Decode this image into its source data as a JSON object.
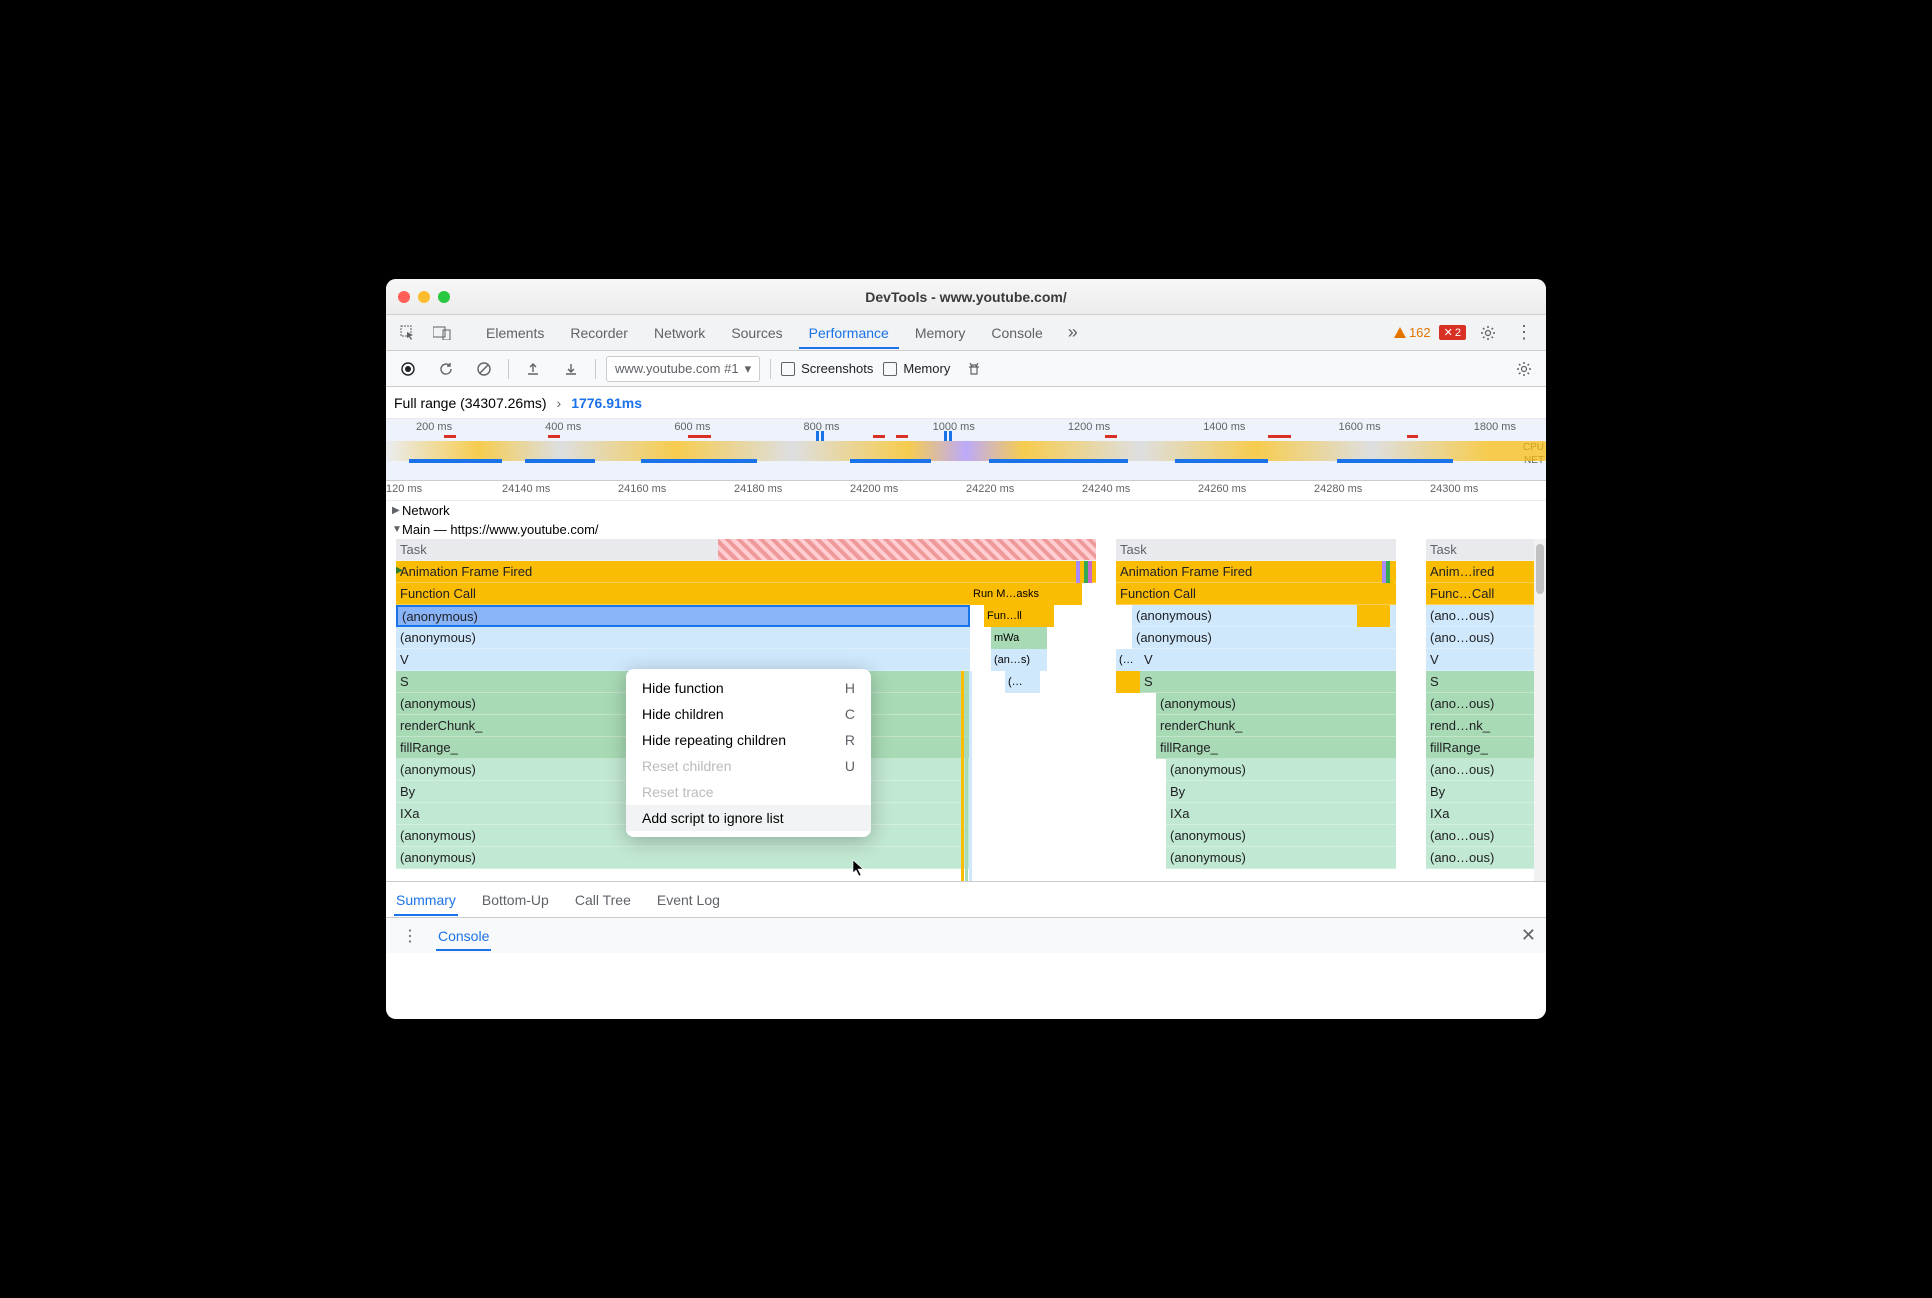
{
  "window_title": "DevTools - www.youtube.com/",
  "tabs": [
    "Elements",
    "Recorder",
    "Network",
    "Sources",
    "Performance",
    "Memory",
    "Console"
  ],
  "active_tab": "Performance",
  "warnings_count": "162",
  "errors_count": "2",
  "toolbar": {
    "dropdown": "www.youtube.com #1",
    "screenshots_label": "Screenshots",
    "memory_label": "Memory"
  },
  "breadcrumb": {
    "full_range": "Full range (34307.26ms)",
    "current": "1776.91ms"
  },
  "overview_ticks": [
    "200 ms",
    "400 ms",
    "600 ms",
    "800 ms",
    "1000 ms",
    "1200 ms",
    "1400 ms",
    "1600 ms",
    "1800 ms"
  ],
  "overview_right_labels": [
    "CPU",
    "NET"
  ],
  "sub_ticks": [
    "120 ms",
    "24140 ms",
    "24160 ms",
    "24180 ms",
    "24200 ms",
    "24220 ms",
    "24240 ms",
    "24260 ms",
    "24280 ms",
    "24300 ms"
  ],
  "sections": {
    "network": "Network",
    "main": "Main — https://www.youtube.com/"
  },
  "flame_main": [
    "Task",
    "Animation Frame Fired",
    "Function Call",
    "(anonymous)",
    "(anonymous)",
    "V",
    "S",
    "(anonymous)",
    "renderChunk_",
    "fillRange_",
    "(anonymous)",
    "By",
    "IXa",
    "(anonymous)",
    "(anonymous)"
  ],
  "flame_slices_side": {
    "run_tasks": "Run M…asks",
    "fun_ll": "Fun…ll",
    "mwa": "mWa",
    "an_s": "(an…s)",
    "paren": "(…"
  },
  "flame_col2": [
    "Task",
    "Animation Frame Fired",
    "Function Call",
    "(anonymous)",
    "(anonymous)",
    "V",
    "S",
    "(anonymous)",
    "renderChunk_",
    "fillRange_",
    "(anonymous)",
    "By",
    "IXa",
    "(anonymous)",
    "(anonymous)"
  ],
  "flame_col2_side": "(…",
  "flame_col3": [
    "Task",
    "Anim…ired",
    "Func…Call",
    "(ano…ous)",
    "(ano…ous)",
    "V",
    "S",
    "(ano…ous)",
    "rend…nk_",
    "fillRange_",
    "(ano…ous)",
    "By",
    "IXa",
    "(ano…ous)",
    "(ano…ous)"
  ],
  "context_menu": [
    {
      "label": "Hide function",
      "shortcut": "H",
      "enabled": true,
      "hover": false
    },
    {
      "label": "Hide children",
      "shortcut": "C",
      "enabled": true,
      "hover": false
    },
    {
      "label": "Hide repeating children",
      "shortcut": "R",
      "enabled": true,
      "hover": false
    },
    {
      "label": "Reset children",
      "shortcut": "U",
      "enabled": false,
      "hover": false
    },
    {
      "label": "Reset trace",
      "shortcut": "",
      "enabled": false,
      "hover": false
    },
    {
      "label": "Add script to ignore list",
      "shortcut": "",
      "enabled": true,
      "hover": true
    }
  ],
  "bottom_tabs": [
    "Summary",
    "Bottom-Up",
    "Call Tree",
    "Event Log"
  ],
  "active_bottom_tab": "Summary",
  "console_label": "Console"
}
